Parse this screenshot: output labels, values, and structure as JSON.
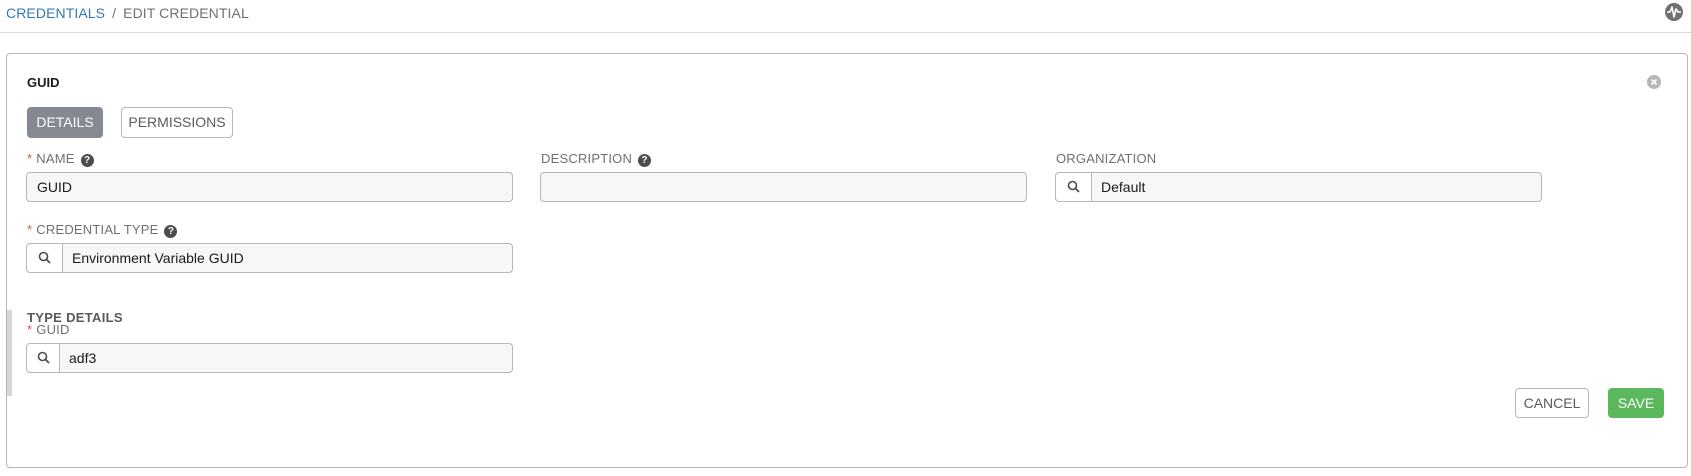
{
  "breadcrumb": {
    "parent": "CREDENTIALS",
    "separator": "/",
    "current": "EDIT CREDENTIAL"
  },
  "topbar": {
    "activity_icon": "activity-stream-icon"
  },
  "panel": {
    "title": "GUID",
    "close_icon": "close-icon",
    "tabs": [
      {
        "label": "DETAILS",
        "active": true
      },
      {
        "label": "PERMISSIONS",
        "active": false
      }
    ]
  },
  "form": {
    "name": {
      "required_mark": "*",
      "label": "NAME",
      "help": "?",
      "value": "GUID"
    },
    "description": {
      "label": "DESCRIPTION",
      "help": "?",
      "value": ""
    },
    "organization": {
      "label": "ORGANIZATION",
      "value": "Default"
    },
    "credential_type": {
      "required_mark": "*",
      "label": "CREDENTIAL TYPE",
      "help": "?",
      "value": "Environment Variable GUID"
    },
    "type_details": {
      "title": "TYPE DETAILS",
      "guid": {
        "required_mark": "*",
        "label": "GUID",
        "value": "adf3"
      }
    }
  },
  "actions": {
    "cancel_label": "CANCEL",
    "save_label": "SAVE"
  },
  "colors": {
    "link": "#337ab7",
    "required": "#d9534f",
    "active_tab": "#848992",
    "save": "#5cb85c"
  }
}
